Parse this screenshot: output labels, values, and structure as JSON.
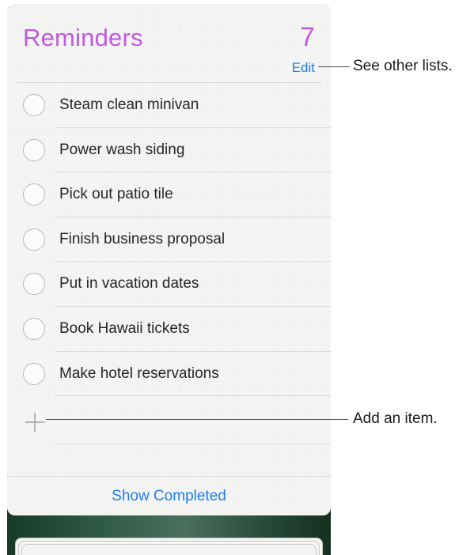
{
  "header": {
    "title": "Reminders",
    "count": "7",
    "edit_label": "Edit"
  },
  "reminders": [
    {
      "label": "Steam clean minivan"
    },
    {
      "label": "Power wash siding"
    },
    {
      "label": "Pick out patio tile"
    },
    {
      "label": "Finish business proposal"
    },
    {
      "label": "Put in vacation dates"
    },
    {
      "label": "Book Hawaii tickets"
    },
    {
      "label": "Make hotel reservations"
    }
  ],
  "footer": {
    "show_completed_label": "Show Completed"
  },
  "callouts": {
    "edit": "See other lists.",
    "add": "Add an item."
  },
  "colors": {
    "accent_purple": "#c05ae0",
    "link_blue": "#1e7ef5"
  },
  "icons": {
    "add": "plus-icon",
    "checkbox": "circle-icon"
  }
}
